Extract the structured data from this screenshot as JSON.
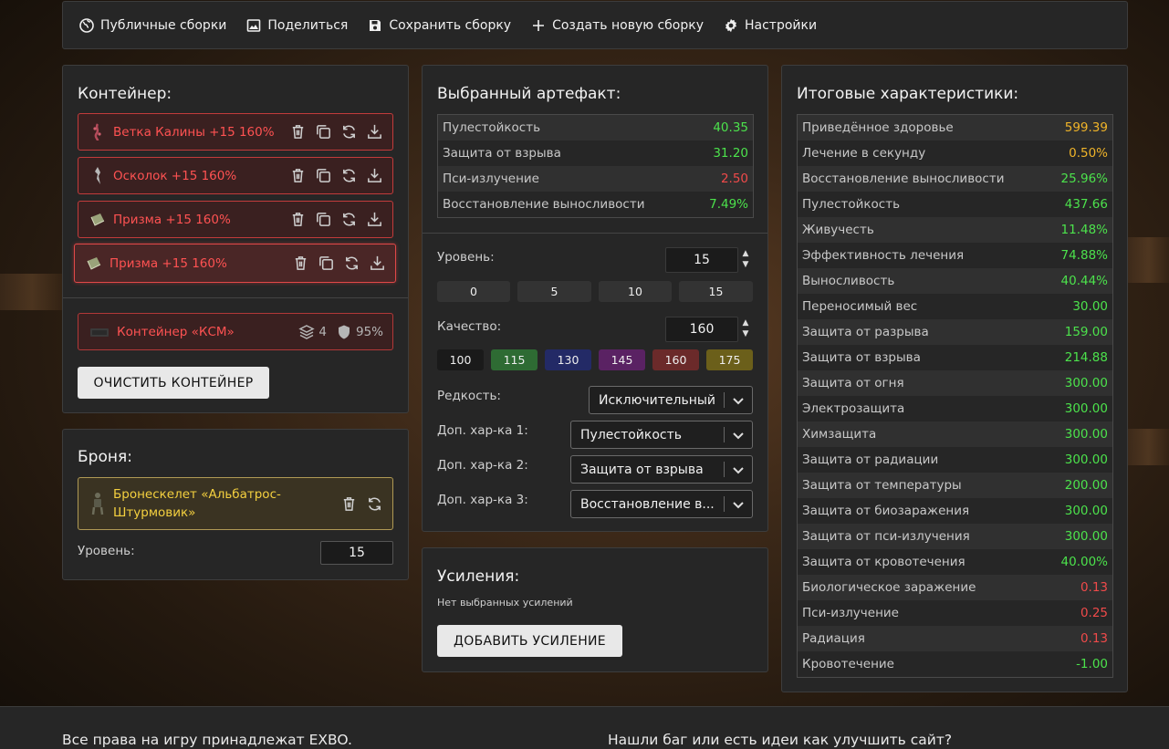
{
  "nav": {
    "items": [
      {
        "label": "Публичные сборки",
        "icon": "globe-icon"
      },
      {
        "label": "Поделиться",
        "icon": "image-icon"
      },
      {
        "label": "Сохранить сборку",
        "icon": "save-icon"
      },
      {
        "label": "Создать новую сборку",
        "icon": "plus-icon"
      },
      {
        "label": "Настройки",
        "icon": "gear-icon"
      }
    ]
  },
  "container": {
    "title": "Контейнер:",
    "artifacts": [
      {
        "name": "Ветка Калины +15 160%"
      },
      {
        "name": "Осколок +15 160%"
      },
      {
        "name": "Призма +15 160%"
      },
      {
        "name": "Призма +15 160%"
      }
    ],
    "ksm": {
      "name": "Контейнер «КСМ»",
      "slots": "4",
      "protection": "95%"
    },
    "clear_button": "ОЧИСТИТЬ КОНТЕЙНЕР"
  },
  "armor": {
    "title": "Броня:",
    "name": "Бронескелет «Альбатрос-Штурмовик»",
    "level_label": "Уровень:",
    "level_value": "15"
  },
  "artifact": {
    "title": "Выбранный артефакт:",
    "stats": [
      {
        "name": "Пулестойкость",
        "value": "40.35",
        "color": "#4ce24c"
      },
      {
        "name": "Защита от взрыва",
        "value": "31.20",
        "color": "#4ce24c"
      },
      {
        "name": "Пси-излучение",
        "value": "2.50",
        "color": "#f04a4a"
      },
      {
        "name": "Восстановление выносливости",
        "value": "7.49%",
        "color": "#4ce24c"
      }
    ],
    "level_label": "Уровень:",
    "level_value": "15",
    "level_presets": [
      "0",
      "5",
      "10",
      "15"
    ],
    "quality_label": "Качество:",
    "quality_value": "160",
    "quality_presets": [
      {
        "label": "100",
        "color": "#1a1a1a"
      },
      {
        "label": "115",
        "color": "#2e6b33"
      },
      {
        "label": "130",
        "color": "#232a66"
      },
      {
        "label": "145",
        "color": "#5a2263"
      },
      {
        "label": "160",
        "color": "#6b2a2a"
      },
      {
        "label": "175",
        "color": "#6b5f1a"
      }
    ],
    "rarity_label": "Редкость:",
    "rarity_value": "Исключительный",
    "extra1_label": "Доп. хар-ка 1:",
    "extra1_value": "Пулестойкость",
    "extra2_label": "Доп. хар-ка 2:",
    "extra2_value": "Защита от взрыва",
    "extra3_label": "Доп. хар-ка 3:",
    "extra3_value": "Восстановление в..."
  },
  "boosts": {
    "title": "Усиления:",
    "empty_text": "Нет выбранных усилений",
    "add_button": "ДОБАВИТЬ УСИЛЕНИЕ"
  },
  "totals": {
    "title": "Итоговые характеристики:",
    "stats": [
      {
        "name": "Приведённое здоровье",
        "value": "599.39",
        "color": "#f0b429"
      },
      {
        "name": "Лечение в секунду",
        "value": "0.50%",
        "color": "#f0b429"
      },
      {
        "name": "Восстановление выносливости",
        "value": "25.96%",
        "color": "#4ce24c"
      },
      {
        "name": "Пулестойкость",
        "value": "437.66",
        "color": "#4ce24c"
      },
      {
        "name": "Живучесть",
        "value": "11.48%",
        "color": "#4ce24c"
      },
      {
        "name": "Эффективность лечения",
        "value": "74.88%",
        "color": "#4ce24c"
      },
      {
        "name": "Выносливость",
        "value": "40.44%",
        "color": "#4ce24c"
      },
      {
        "name": "Переносимый вес",
        "value": "30.00",
        "color": "#4ce24c"
      },
      {
        "name": "Защита от разрыва",
        "value": "159.00",
        "color": "#4ce24c"
      },
      {
        "name": "Защита от взрыва",
        "value": "214.88",
        "color": "#4ce24c"
      },
      {
        "name": "Защита от огня",
        "value": "300.00",
        "color": "#4ce24c"
      },
      {
        "name": "Электрозащита",
        "value": "300.00",
        "color": "#4ce24c"
      },
      {
        "name": "Химзащита",
        "value": "300.00",
        "color": "#4ce24c"
      },
      {
        "name": "Защита от радиации",
        "value": "300.00",
        "color": "#4ce24c"
      },
      {
        "name": "Защита от температуры",
        "value": "200.00",
        "color": "#4ce24c"
      },
      {
        "name": "Защита от биозаражения",
        "value": "300.00",
        "color": "#4ce24c"
      },
      {
        "name": "Защита от пси-излучения",
        "value": "300.00",
        "color": "#4ce24c"
      },
      {
        "name": "Защита от кровотечения",
        "value": "40.00%",
        "color": "#4ce24c"
      },
      {
        "name": "Биологическое заражение",
        "value": "0.13",
        "color": "#f04a4a"
      },
      {
        "name": "Пси-излучение",
        "value": "0.25",
        "color": "#f04a4a"
      },
      {
        "name": "Радиация",
        "value": "0.13",
        "color": "#f04a4a"
      },
      {
        "name": "Кровотечение",
        "value": "-1.00",
        "color": "#4ce24c"
      }
    ]
  },
  "footer": {
    "left": "Все права на игру принадлежат EXBO.",
    "right": "Нашли баг или есть идеи как улучшить сайт?"
  }
}
